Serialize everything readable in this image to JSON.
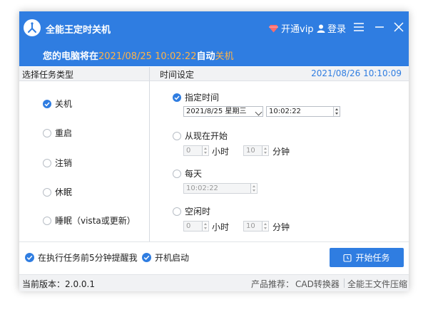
{
  "window": {
    "title": "全能王定时关机",
    "vip_label": "开通vip",
    "login_label": "登录",
    "notice_prefix": "您的电脑将在",
    "notice_datetime": "2021/08/25 10:02:22",
    "notice_suffix": "自动",
    "notice_action": "关机",
    "accent_color": "#2f7de1",
    "highlight_color": "#ffb347"
  },
  "left_panel": {
    "header": "选择任务类型",
    "options": [
      {
        "label": "关机",
        "selected": true
      },
      {
        "label": "重启",
        "selected": false
      },
      {
        "label": "注销",
        "selected": false
      },
      {
        "label": "休眠",
        "selected": false
      },
      {
        "label": "睡眠（vista或更新）",
        "selected": false
      }
    ]
  },
  "right_panel": {
    "header": "时间设定",
    "current_time": "2021/08/26 10:10:09",
    "specified": {
      "label": "指定时间",
      "date_value": "2021/8/25  星期三",
      "time_value": "10:02:22"
    },
    "from_now": {
      "label": "从现在开始",
      "hours": "0",
      "hours_unit": "小时",
      "minutes": "10",
      "minutes_unit": "分钟"
    },
    "daily": {
      "label": "每天",
      "time_value": "10:02:22"
    },
    "idle": {
      "label": "空闲时",
      "hours": "0",
      "hours_unit": "小时",
      "minutes": "10",
      "minutes_unit": "分钟"
    }
  },
  "bottom": {
    "remind_label": "在执行任务前5分钟提醒我",
    "autostart_label": "开机启动",
    "start_button": "开始任务"
  },
  "status": {
    "version": "当前版本：2.0.0.1",
    "recommend_label": "产品推荐：",
    "product1": "CAD转换器",
    "product2": "全能王文件压缩"
  }
}
